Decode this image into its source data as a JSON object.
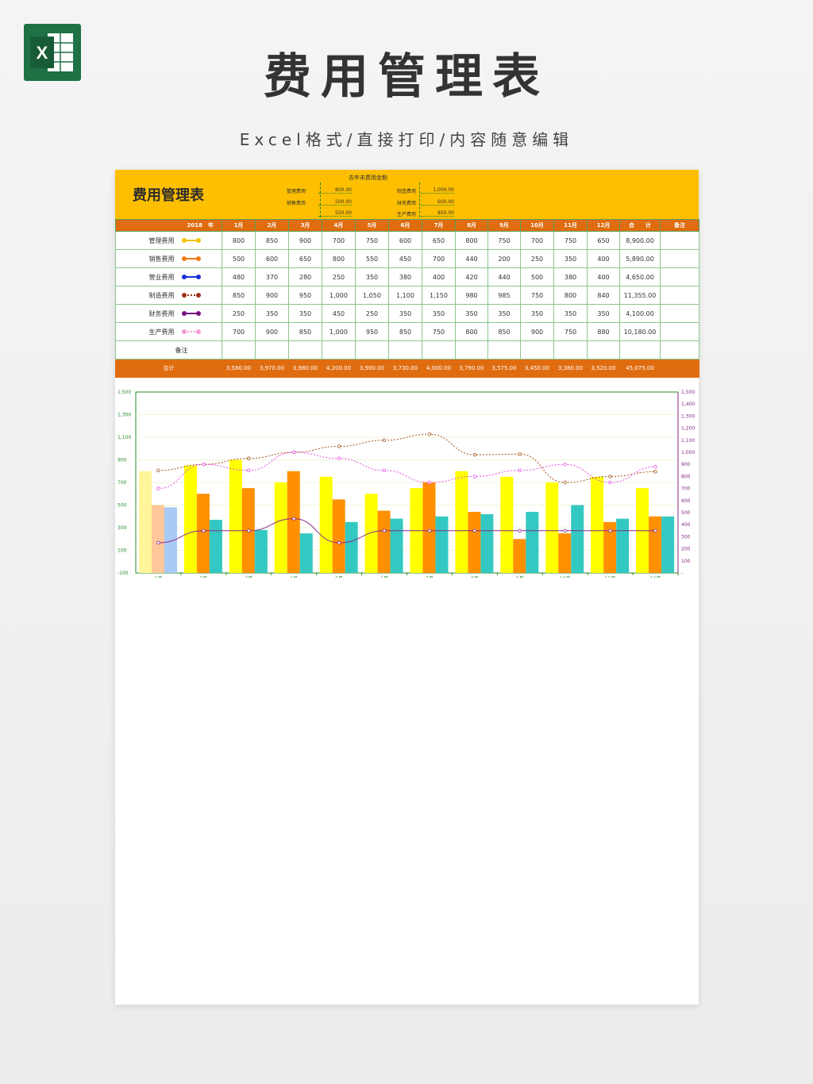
{
  "header": {
    "title": "费用管理表",
    "subtitle": "Excel格式/直接打印/内容随意编辑"
  },
  "logo": {
    "icon": "excel-icon",
    "letter": "X",
    "color": "#1e7145"
  },
  "sheet": {
    "title": "费用管理表",
    "prev_year": {
      "title": "去年末费用金额",
      "items": [
        {
          "label": "管理费用",
          "value": "800.00"
        },
        {
          "label": "制造费用",
          "value": "1,000.00"
        },
        {
          "label": "销售费用",
          "value": "500.00"
        },
        {
          "label": "财务费用",
          "value": "600.00"
        },
        {
          "label": "",
          "value": "550.00"
        },
        {
          "label": "生产费用",
          "value": "850.00"
        }
      ]
    },
    "year_label": "2018　年",
    "months": [
      "1月",
      "2月",
      "3月",
      "4月",
      "5月",
      "6月",
      "7月",
      "8月",
      "9月",
      "10月",
      "11月",
      "12月"
    ],
    "total_col": "合　　计",
    "remark_col": "备注",
    "rows": [
      {
        "label": "管理费用",
        "color": "#f2c500",
        "style": "solid",
        "values": [
          "800",
          "850",
          "900",
          "700",
          "750",
          "600",
          "650",
          "800",
          "750",
          "700",
          "750",
          "650"
        ],
        "total": "8,900.00"
      },
      {
        "label": "销售费用",
        "color": "#f07a10",
        "style": "solid",
        "values": [
          "500",
          "600",
          "650",
          "800",
          "550",
          "450",
          "700",
          "440",
          "200",
          "250",
          "350",
          "400"
        ],
        "total": "5,890.00"
      },
      {
        "label": "营业费用",
        "color": "#1b2fd6",
        "style": "solid",
        "values": [
          "480",
          "370",
          "280",
          "250",
          "350",
          "380",
          "400",
          "420",
          "440",
          "500",
          "380",
          "400"
        ],
        "total": "4,650.00"
      },
      {
        "label": "制造费用",
        "color": "#a0321a",
        "style": "dotted",
        "values": [
          "850",
          "900",
          "950",
          "1,000",
          "1,050",
          "1,100",
          "1,150",
          "980",
          "985",
          "750",
          "800",
          "840"
        ],
        "total": "11,355.00"
      },
      {
        "label": "财务费用",
        "color": "#7a1080",
        "style": "solid",
        "values": [
          "250",
          "350",
          "350",
          "450",
          "250",
          "350",
          "350",
          "350",
          "350",
          "350",
          "350",
          "350"
        ],
        "total": "4,100.00"
      },
      {
        "label": "生产费用",
        "color": "#f59bd5",
        "style": "dotted",
        "values": [
          "700",
          "900",
          "850",
          "1,000",
          "950",
          "850",
          "750",
          "800",
          "850",
          "900",
          "750",
          "880"
        ],
        "total": "10,180.00"
      }
    ],
    "remark_row": "备注",
    "total_row": {
      "label": "合计",
      "values": [
        "3,580.00",
        "3,970.00",
        "3,980.00",
        "4,200.00",
        "3,900.00",
        "3,730.00",
        "4,000.00",
        "3,790.00",
        "3,575.00",
        "3,450.00",
        "3,380.00",
        "3,520.00"
      ],
      "grand_total": "45,075.00"
    }
  },
  "chart_data": {
    "type": "bar",
    "categories": [
      "1月",
      "2月",
      "3月",
      "4月",
      "5月",
      "6月",
      "7月",
      "8月",
      "9月",
      "10月",
      "11月",
      "12月"
    ],
    "ylim": [
      -100,
      1500
    ],
    "y2lim": [
      0,
      1500
    ],
    "yticks": [
      "1,500",
      "1,300",
      "1,100",
      "900",
      "700",
      "500",
      "300",
      "100",
      "-100"
    ],
    "y2ticks": [
      "1,500",
      "1,400",
      "1,300",
      "1,200",
      "1,100",
      "1,000",
      "900",
      "800",
      "700",
      "600",
      "500",
      "400",
      "300",
      "200",
      "100",
      "-"
    ],
    "bar_series": [
      {
        "values": [
          800,
          850,
          900,
          700,
          750,
          600,
          650,
          800,
          750,
          700,
          750,
          650
        ],
        "color": "#ffff00",
        "first_color": "#fff59a"
      },
      {
        "values": [
          500,
          600,
          650,
          800,
          550,
          450,
          700,
          440,
          200,
          250,
          350,
          400
        ],
        "color": "#ff9000",
        "first_color": "#ffc79a"
      },
      {
        "values": [
          480,
          370,
          280,
          250,
          350,
          380,
          400,
          420,
          440,
          500,
          380,
          400
        ],
        "color": "#33c9c2",
        "first_color": "#a8cbf5"
      }
    ],
    "line_series": [
      {
        "values": [
          850,
          900,
          950,
          1000,
          1050,
          1100,
          1150,
          980,
          985,
          750,
          800,
          840
        ],
        "color": "#a0521a",
        "dash": "2,2"
      },
      {
        "values": [
          250,
          350,
          350,
          450,
          250,
          350,
          350,
          350,
          350,
          350,
          350,
          350
        ],
        "color": "#8a2a8a",
        "dash": ""
      },
      {
        "values": [
          700,
          900,
          850,
          1000,
          950,
          850,
          750,
          800,
          850,
          900,
          750,
          880
        ],
        "color": "#e64ce6",
        "dash": "2,2"
      }
    ]
  }
}
